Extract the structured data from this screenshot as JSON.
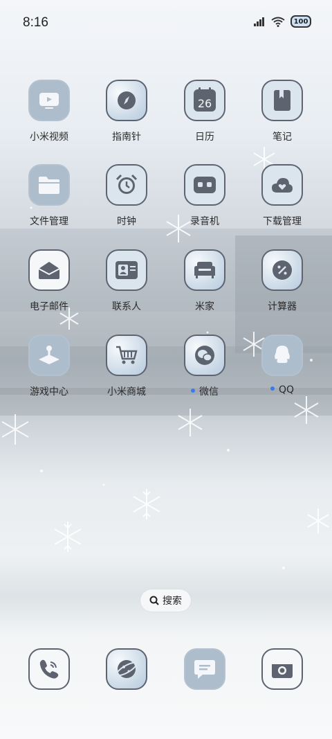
{
  "status": {
    "time": "8:16",
    "battery": "100"
  },
  "apps": [
    {
      "label": "小米视频",
      "icon": "tv-icon",
      "dot": false
    },
    {
      "label": "指南针",
      "icon": "compass-icon",
      "dot": false
    },
    {
      "label": "日历",
      "icon": "calendar-icon",
      "day": "26",
      "dot": false
    },
    {
      "label": "笔记",
      "icon": "notebook-icon",
      "dot": false
    },
    {
      "label": "文件管理",
      "icon": "folder-icon",
      "dot": false
    },
    {
      "label": "时钟",
      "icon": "alarm-clock-icon",
      "dot": false
    },
    {
      "label": "录音机",
      "icon": "recorder-icon",
      "dot": false
    },
    {
      "label": "下载管理",
      "icon": "cloud-download-icon",
      "dot": false
    },
    {
      "label": "电子邮件",
      "icon": "mail-icon",
      "dot": false
    },
    {
      "label": "联系人",
      "icon": "contact-card-icon",
      "dot": false
    },
    {
      "label": "米家",
      "icon": "sofa-icon",
      "dot": false
    },
    {
      "label": "计算器",
      "icon": "calculator-icon",
      "dot": false
    },
    {
      "label": "游戏中心",
      "icon": "joystick-icon",
      "dot": false
    },
    {
      "label": "小米商城",
      "icon": "shopping-cart-icon",
      "dot": false
    },
    {
      "label": "微信",
      "icon": "wechat-icon",
      "dot": true
    },
    {
      "label": "QQ",
      "icon": "qq-penguin-icon",
      "dot": true
    }
  ],
  "search": {
    "label": "搜索"
  },
  "dock": [
    {
      "icon": "phone-icon"
    },
    {
      "icon": "browser-icon"
    },
    {
      "icon": "message-icon"
    },
    {
      "icon": "camera-icon"
    }
  ],
  "colors": {
    "icon_glyph": "#5d6470",
    "notification_dot": "#3a7be8"
  }
}
